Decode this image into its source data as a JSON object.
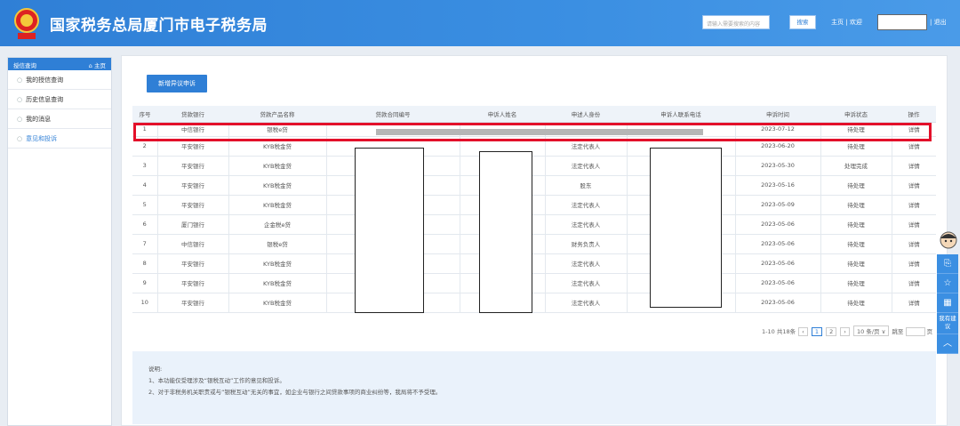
{
  "header": {
    "title": "国家税务总局厦门市电子税务局",
    "search_placeholder": "请输入需要搜索的内容",
    "search_label": "搜索",
    "home_link": "主页",
    "welcome_label": "欢迎",
    "logout_label": "退出"
  },
  "sidebar": {
    "head": "授信查询",
    "home": "⌂ 主页",
    "items": [
      {
        "label": "我的授信查询"
      },
      {
        "label": "历史信息查询"
      },
      {
        "label": "我的消息"
      },
      {
        "label": "意见和投诉"
      }
    ]
  },
  "toolbar": {
    "new_label": "新增异议申诉"
  },
  "table": {
    "headers": [
      "序号",
      "贷款银行",
      "贷款产品名称",
      "贷款合同编号",
      "申诉人姓名",
      "申述人身份",
      "申诉人联系电话",
      "申诉时间",
      "申诉状态",
      "操作"
    ],
    "rows": [
      {
        "no": "1",
        "bank": "中信银行",
        "product": "银税e贷",
        "identity": "",
        "time": "2023-07-12",
        "status": "待处理",
        "action": "详情"
      },
      {
        "no": "2",
        "bank": "平安银行",
        "product": "KYB税金贷",
        "identity": "法定代表人",
        "time": "2023-06-20",
        "status": "待处理",
        "action": "详情"
      },
      {
        "no": "3",
        "bank": "平安银行",
        "product": "KYB税金贷",
        "identity": "法定代表人",
        "time": "2023-05-30",
        "status": "处理完成",
        "action": "详情"
      },
      {
        "no": "4",
        "bank": "平安银行",
        "product": "KYB税金贷",
        "identity": "股东",
        "time": "2023-05-16",
        "status": "待处理",
        "action": "详情"
      },
      {
        "no": "5",
        "bank": "平安银行",
        "product": "KYB税金贷",
        "identity": "法定代表人",
        "time": "2023-05-09",
        "status": "待处理",
        "action": "详情"
      },
      {
        "no": "6",
        "bank": "厦门银行",
        "product": "企金税e贷",
        "identity": "法定代表人",
        "time": "2023-05-06",
        "status": "待处理",
        "action": "详情"
      },
      {
        "no": "7",
        "bank": "中信银行",
        "product": "银税e贷",
        "identity": "财务负责人",
        "time": "2023-05-06",
        "status": "待处理",
        "action": "详情"
      },
      {
        "no": "8",
        "bank": "平安银行",
        "product": "KYB税金贷",
        "identity": "法定代表人",
        "time": "2023-05-06",
        "status": "待处理",
        "action": "详情"
      },
      {
        "no": "9",
        "bank": "平安银行",
        "product": "KYB税金贷",
        "identity": "法定代表人",
        "time": "2023-05-06",
        "status": "待处理",
        "action": "详情"
      },
      {
        "no": "10",
        "bank": "平安银行",
        "product": "KYB税金贷",
        "identity": "法定代表人",
        "time": "2023-05-06",
        "status": "待处理",
        "action": "详情"
      }
    ]
  },
  "pager": {
    "summary": "1-10 共18条",
    "prev": "‹",
    "page1": "1",
    "page2": "2",
    "next": "›",
    "size": "10 条/页 ∨",
    "jump": "跳至",
    "unit": "页"
  },
  "notes": {
    "title": "说明:",
    "line1": "1、本功能仅受理涉及“银税互动”工作的意见和投诉。",
    "line2": "2、对于非税务机关职责或与“银税互动”无关的事宜，如企业与银行之间贷款事项的商业纠纷等，我局将不予受理。"
  },
  "float_rail": {
    "suggest": "我有建议"
  },
  "colors": {
    "brand": "#2f7fd6",
    "highlight": "#e3102a"
  }
}
